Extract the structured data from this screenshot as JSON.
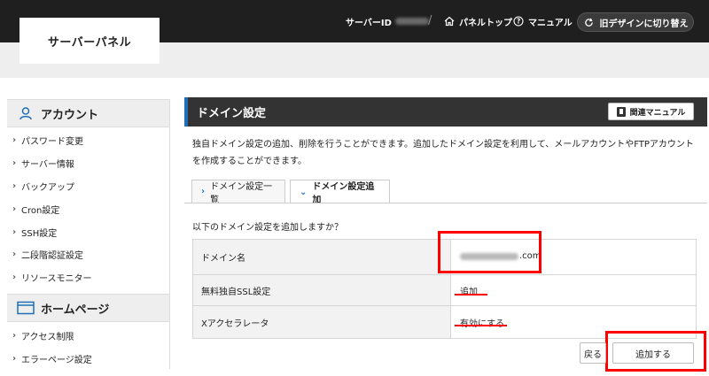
{
  "header": {
    "logo": "サーバーパネル",
    "server_id_label": "サーバーID",
    "separator": "/",
    "panel_top": "パネルトップ",
    "manual": "マニュアル",
    "old_design_button": "旧デザインに切り替え"
  },
  "sidebar": {
    "sections": [
      {
        "title": "アカウント",
        "icon": "user-icon",
        "items": [
          "パスワード変更",
          "サーバー情報",
          "バックアップ",
          "Cron設定",
          "SSH設定",
          "二段階認証設定",
          "リソースモニター"
        ]
      },
      {
        "title": "ホームページ",
        "icon": "window-icon",
        "items": [
          "アクセス制限",
          "エラーページ設定"
        ]
      }
    ]
  },
  "main": {
    "title": "ドメイン設定",
    "manual_button": "関連マニュアル",
    "description": "独自ドメイン設定の追加、削除を行うことができます。追加したドメイン設定を利用して、メールアカウントやFTPアカウントを作成することができます。",
    "tabs": [
      {
        "label": "ドメイン設定一覧",
        "active": false
      },
      {
        "label": "ドメイン設定追加",
        "active": true
      }
    ],
    "confirm_question": "以下のドメイン設定を追加しますか？",
    "rows": [
      {
        "label": "ドメイン名",
        "value": ".com"
      },
      {
        "label": "無料独自SSL設定",
        "value": "追加"
      },
      {
        "label": "Xアクセラレータ",
        "value": "有効にする"
      }
    ],
    "back_button": "戻る",
    "add_button": "追加する"
  },
  "colors": {
    "header_bg": "#1f1f1f",
    "title_bar_bg": "#333333",
    "accent_blue": "#1e6fb8",
    "highlight_red": "#ff0000"
  }
}
